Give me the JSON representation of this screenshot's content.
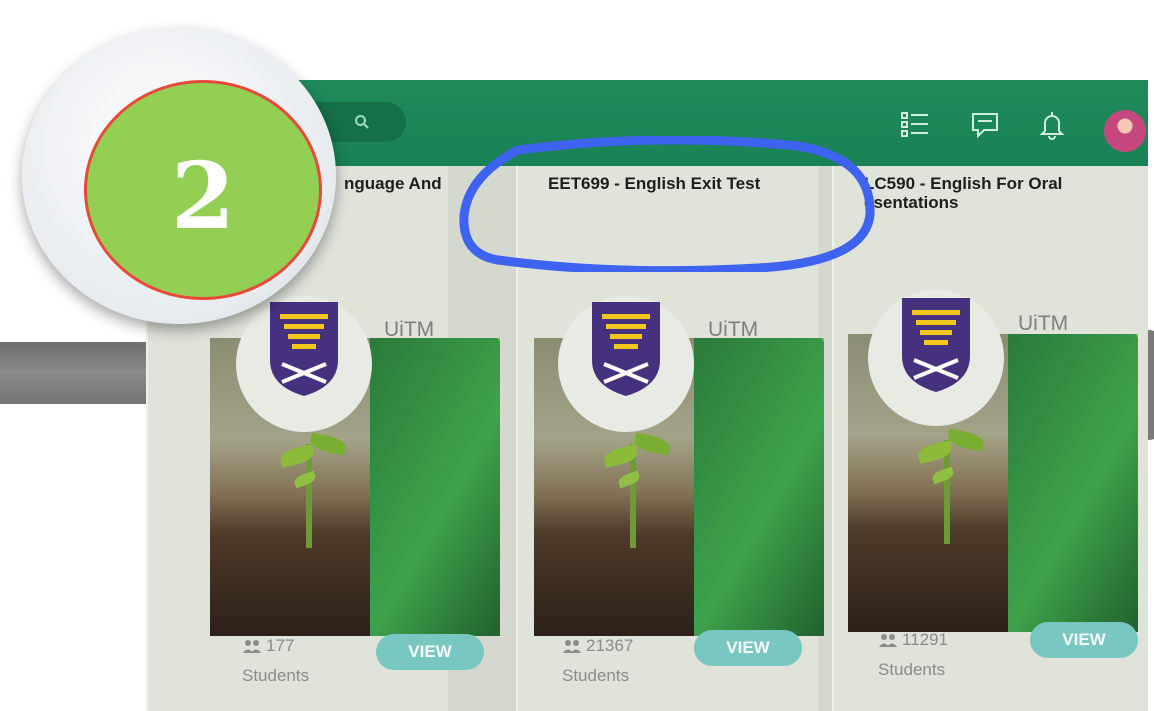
{
  "badge": {
    "number": "2"
  },
  "courses": [
    {
      "title": "nguage And",
      "brand": "UiTM",
      "student_count": "177",
      "students_label": "Students",
      "view_label": "VIEW"
    },
    {
      "title": "EET699 - English Exit Test",
      "brand": "UiTM",
      "student_count": "21367",
      "students_label": "Students",
      "view_label": "VIEW"
    },
    {
      "title": "LC590 - English For Oral\nesentations",
      "brand": "UiTM",
      "student_count": "11291",
      "students_label": "Students",
      "view_label": "VIEW"
    }
  ],
  "colors": {
    "header": "#1f8a5a",
    "view_button": "#79c7c1",
    "badge_fill": "#92cf52",
    "badge_ring": "#e84a3a",
    "highlight": "#3d63f0"
  },
  "icons": [
    "search-icon",
    "list-icon",
    "message-icon",
    "bell-icon",
    "users-icon"
  ]
}
